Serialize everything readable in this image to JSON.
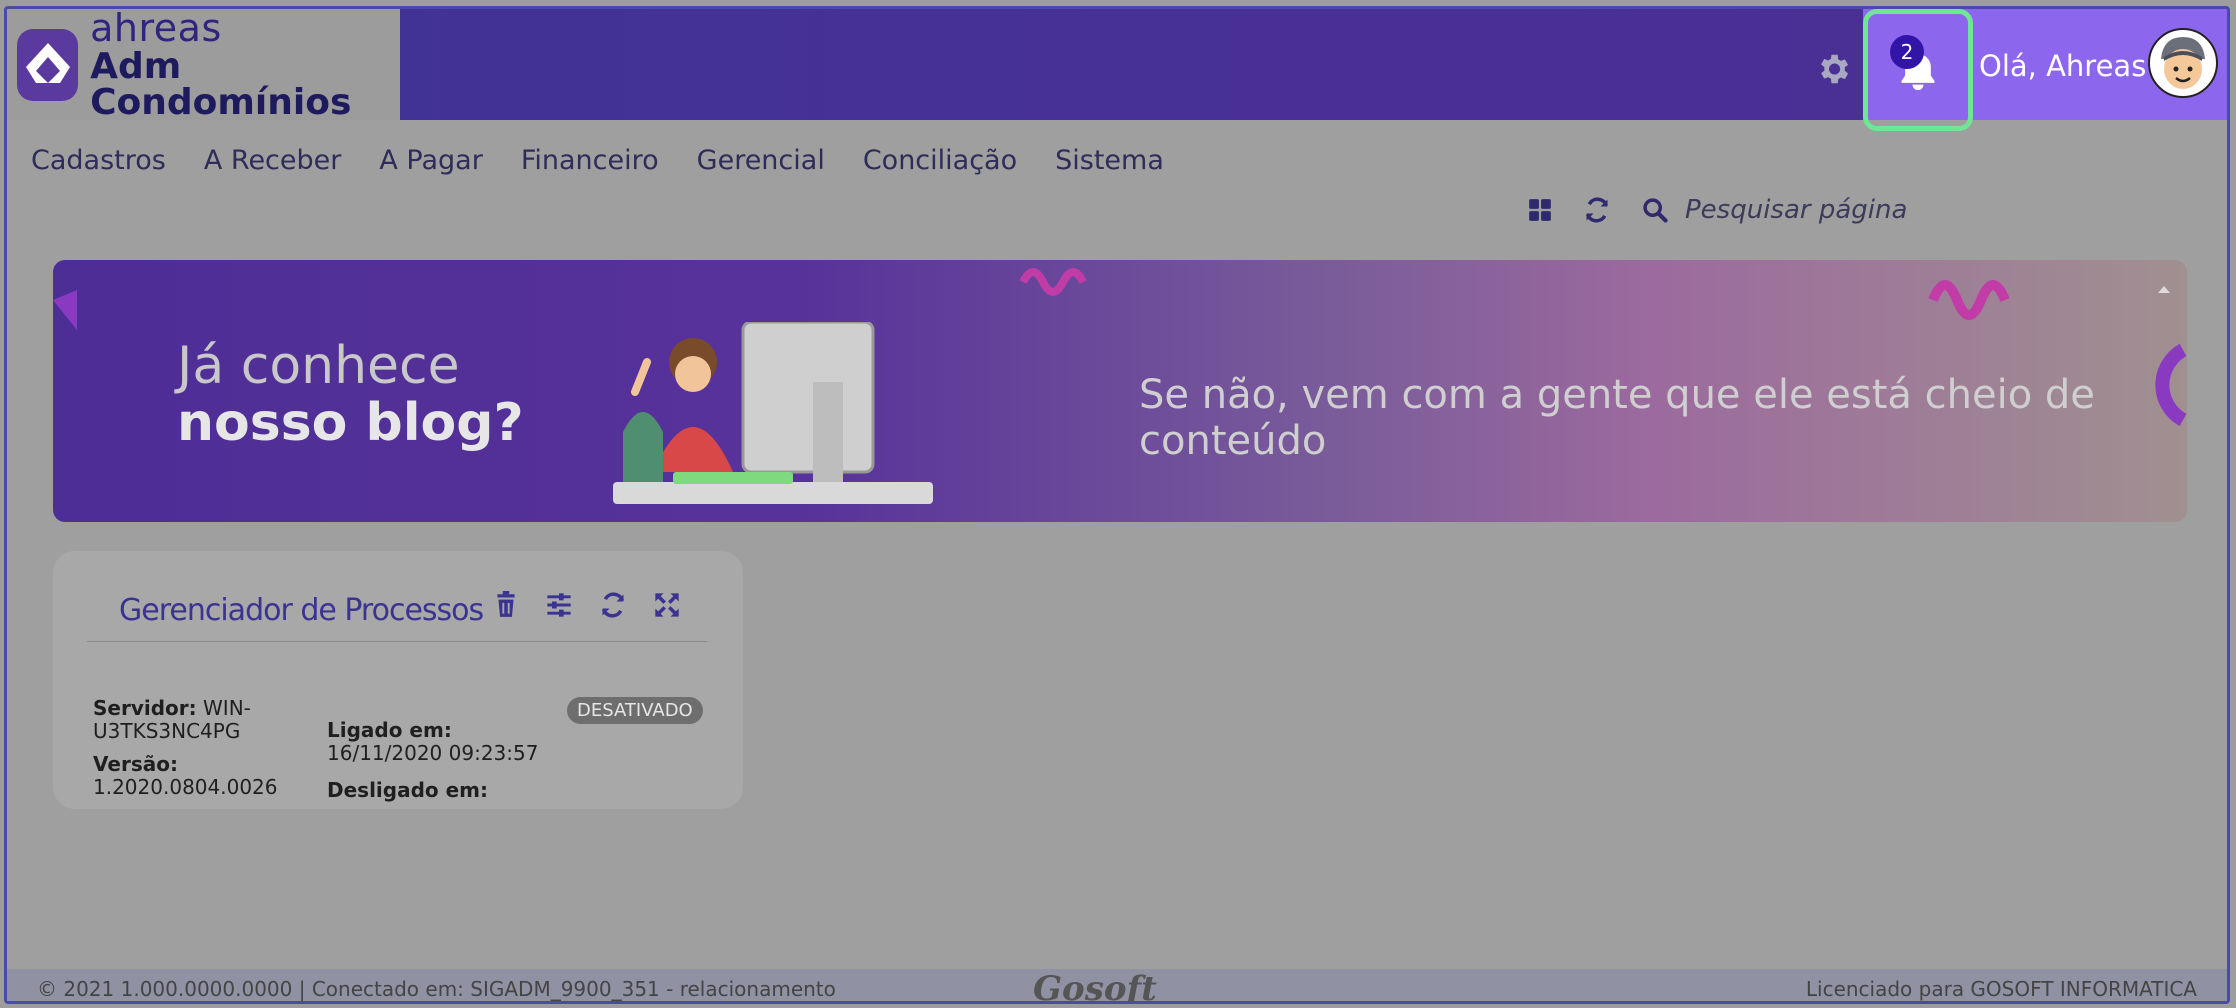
{
  "header": {
    "logo_line1": "ahreas",
    "logo_line2": "Adm Condomínios",
    "notification_count": "2",
    "greeting": "Olá, Ahreas"
  },
  "menu": {
    "items": [
      "Cadastros",
      "A Receber",
      "A Pagar",
      "Financeiro",
      "Gerencial",
      "Conciliação",
      "Sistema"
    ]
  },
  "toolbar": {
    "search_placeholder": "Pesquisar página"
  },
  "banner": {
    "headline_line1": "Já conhece",
    "headline_line2": "nosso blog?",
    "subtitle": "Se não, vem com a gente que ele está cheio de conteúdo"
  },
  "process_card": {
    "title": "Gerenciador de Processos",
    "status": "DESATIVADO",
    "server_label": "Servidor:",
    "server_value": "WIN-U3TKS3NC4PG",
    "version_label": "Versão:",
    "version_value": "1.2020.0804.0026",
    "on_label": "Ligado em:",
    "on_value": "16/11/2020 09:23:57",
    "off_label": "Desligado em:"
  },
  "footer": {
    "left": "© 2021  1.000.0000.0000 | Conectado em: SIGADM_9900_351 - relacionamento",
    "brand": "Gosoft",
    "right": "Licenciado para GOSOFT INFORMATICA"
  },
  "colors": {
    "header_bg": "#463196",
    "highlight": "#6fe596",
    "accent": "#3a3391"
  }
}
